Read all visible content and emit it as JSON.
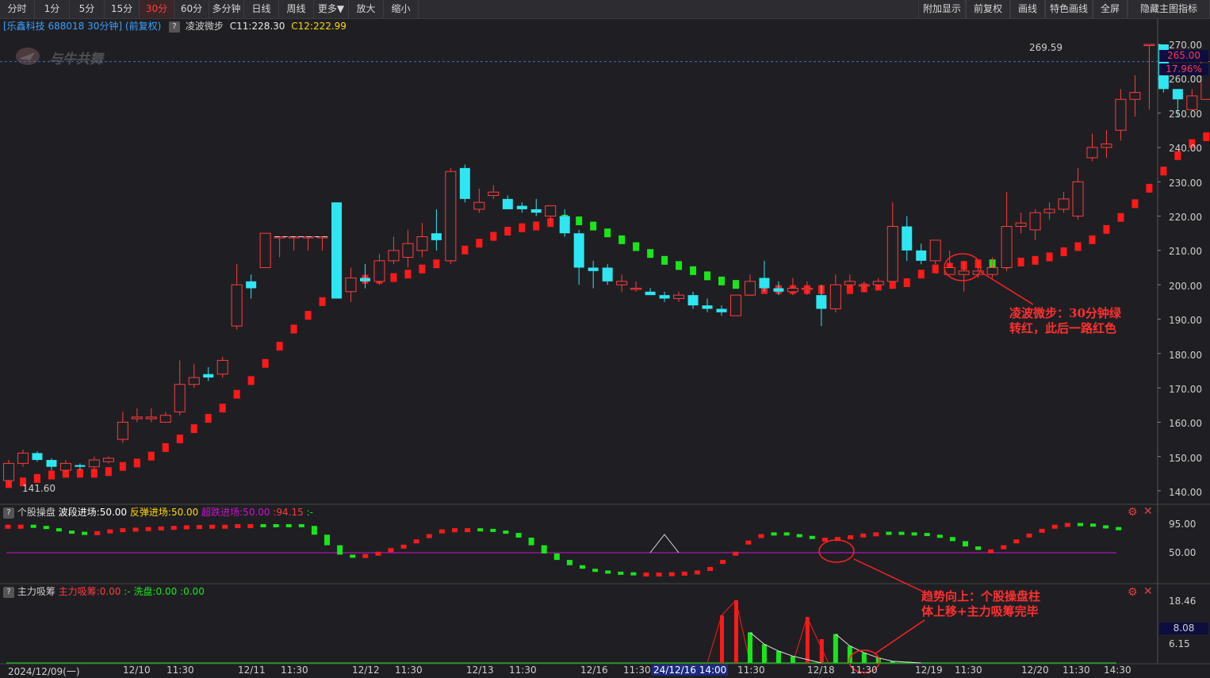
{
  "toolbar": {
    "left": [
      "分时",
      "1分",
      "5分",
      "15分",
      "30分",
      "60分",
      "多分钟",
      "日线",
      "周线",
      "更多▼",
      "放大",
      "缩小"
    ],
    "right": [
      "附加显示",
      "前复权",
      "画线",
      "特色画线",
      "全屏",
      "隐藏主图指标"
    ],
    "active": "30分"
  },
  "info": {
    "title": "[乐鑫科技 688018 30分钟] (前复权)",
    "indicator": "凌波微步",
    "c11": "C11:228.30",
    "c12": "C12:222.99"
  },
  "watermark": "与牛共舞",
  "price_axis": {
    "ticks": [
      "270.00",
      "260.00",
      "250.00",
      "240.00",
      "230.00",
      "220.00",
      "210.00",
      "200.00",
      "190.00",
      "180.00",
      "170.00",
      "160.00",
      "150.00",
      "140.00"
    ],
    "current": "265.00",
    "change": "17.96%",
    "high_label": "269.59",
    "low_label": "141.60"
  },
  "panel1": {
    "name": "个股操盘",
    "a": "波段进场:50.00",
    "b": "反弹进场:50.00",
    "c": "超跌进场:50.00",
    "d": ":94.15",
    "e": ":-",
    "ticks": [
      "95.00",
      "50.00"
    ]
  },
  "panel2": {
    "name": "主力吸筹",
    "a": "主力吸筹:0.00",
    "b": ":-",
    "c": "洗盘:0.00",
    "d": ":0.00",
    "ticks": [
      "18.46",
      "8.08",
      "6.15"
    ]
  },
  "x_axis": [
    "2024/12/09(一)",
    "12/10",
    "11:30",
    "12/11",
    "11:30",
    "12/12",
    "11:30",
    "12/13",
    "11:30",
    "12/16",
    "11:30",
    "24/12/16 14:00",
    "11:30",
    "12/18",
    "11:30",
    "12/19",
    "11:30",
    "12/20",
    "11:30",
    "14:30"
  ],
  "annotations": {
    "a1_line1": "凌波微步：30分钟绿",
    "a1_line2": "转红，此后一路红色",
    "a2_line1": "趋势向上：个股操盘柱",
    "a2_line2": "体上移+主力吸筹完毕"
  },
  "colors": {
    "up": "#ff3b3b",
    "down": "#2ee6f2",
    "green": "#19e619",
    "cyan": "#2ee6f2",
    "magenta": "#d010d0",
    "yellow": "#ffd800"
  },
  "chart_data": {
    "type": "candlestick",
    "interval": "30min",
    "ylim": [
      137,
      273
    ],
    "candles": [
      [
        143,
        148,
        141.6,
        149
      ],
      [
        148,
        151,
        147,
        152
      ],
      [
        151,
        149,
        148.5,
        151.5
      ],
      [
        149,
        147,
        146,
        149.5
      ],
      [
        146,
        148,
        145.5,
        149
      ],
      [
        147.5,
        147,
        146,
        148
      ],
      [
        147,
        149,
        146,
        150
      ],
      [
        148.5,
        149.5,
        148,
        150
      ],
      [
        155,
        160,
        154,
        163
      ],
      [
        161,
        161.5,
        160,
        164
      ],
      [
        161,
        161.5,
        160,
        164
      ],
      [
        160,
        162,
        160,
        163
      ],
      [
        163,
        171,
        162,
        178
      ],
      [
        171,
        173,
        170,
        177
      ],
      [
        174,
        173,
        172,
        176
      ],
      [
        174,
        178,
        173,
        179
      ],
      [
        188,
        200,
        187,
        206
      ],
      [
        201,
        199,
        196,
        203
      ],
      [
        205,
        215,
        205,
        215
      ],
      [
        214,
        214,
        208,
        214
      ],
      [
        214,
        214,
        210,
        214
      ],
      [
        214,
        214,
        210,
        214
      ],
      [
        214,
        214,
        210,
        214
      ],
      [
        224,
        196,
        196,
        224
      ],
      [
        198,
        202,
        195,
        205
      ],
      [
        202,
        201,
        199,
        206
      ],
      [
        201,
        207,
        200,
        209
      ],
      [
        207,
        210,
        206,
        214
      ],
      [
        208,
        212,
        205,
        216
      ],
      [
        210,
        214,
        208,
        218
      ],
      [
        215,
        213,
        210,
        222
      ],
      [
        207,
        233,
        206,
        234
      ],
      [
        234,
        225,
        224,
        235
      ],
      [
        222,
        224,
        221,
        228
      ],
      [
        226,
        227,
        225,
        229
      ],
      [
        225,
        222,
        222,
        226
      ],
      [
        223,
        222,
        221,
        224
      ],
      [
        222,
        221,
        220,
        225
      ],
      [
        220,
        223,
        218,
        223
      ],
      [
        220,
        215,
        214,
        222
      ],
      [
        215,
        205,
        200,
        216
      ],
      [
        205,
        204,
        199,
        207
      ],
      [
        205,
        201,
        200,
        206
      ],
      [
        200,
        201,
        198,
        203
      ],
      [
        199,
        199,
        198,
        201
      ],
      [
        198,
        197,
        197,
        199
      ],
      [
        197,
        196,
        195,
        198
      ],
      [
        196,
        197,
        195,
        198
      ],
      [
        197,
        194,
        193,
        198
      ],
      [
        194,
        193,
        192,
        196
      ],
      [
        193,
        192,
        191,
        194
      ],
      [
        191,
        197,
        191,
        197
      ],
      [
        197,
        201,
        197,
        203
      ],
      [
        202,
        199,
        198,
        207
      ],
      [
        199,
        198,
        197,
        201
      ],
      [
        198,
        199,
        197,
        202
      ],
      [
        199,
        199,
        197,
        201
      ],
      [
        197,
        193,
        188,
        200
      ],
      [
        193,
        200,
        192,
        203
      ],
      [
        200,
        201,
        199,
        203
      ],
      [
        200,
        200,
        198,
        201
      ],
      [
        200,
        201,
        199,
        202
      ],
      [
        201,
        217,
        201,
        224
      ],
      [
        217,
        210,
        207,
        220
      ],
      [
        210,
        207,
        206,
        212
      ],
      [
        207,
        213,
        206,
        213
      ],
      [
        203,
        205,
        203,
        210
      ],
      [
        203,
        204,
        198,
        207
      ],
      [
        203,
        204,
        202,
        207
      ],
      [
        203,
        205,
        202,
        208
      ],
      [
        205,
        217,
        204,
        227
      ],
      [
        217,
        218,
        215,
        221
      ],
      [
        216,
        221,
        213,
        222
      ],
      [
        221,
        222,
        219,
        224
      ],
      [
        222,
        225,
        221,
        227
      ],
      [
        220,
        230,
        219,
        234
      ],
      [
        237,
        240,
        236,
        244
      ],
      [
        240,
        241,
        237,
        245
      ],
      [
        245,
        254,
        242,
        257
      ],
      [
        254,
        256,
        249,
        261
      ],
      [
        270,
        270,
        251,
        270
      ],
      [
        270,
        257,
        256,
        270
      ],
      [
        257,
        254,
        249,
        257
      ],
      [
        251,
        255,
        251,
        257
      ],
      [
        254,
        265,
        254,
        265
      ]
    ],
    "lingbo": [
      [
        "r",
        142
      ],
      [
        "r",
        142.5
      ],
      [
        "r",
        143.5
      ],
      [
        "r",
        144.5
      ],
      [
        "r",
        145
      ],
      [
        "r",
        145
      ],
      [
        "r",
        145
      ],
      [
        "r",
        145.5
      ],
      [
        "r",
        147
      ],
      [
        "r",
        148
      ],
      [
        "r",
        150
      ],
      [
        "r",
        152.5
      ],
      [
        "r",
        155
      ],
      [
        "r",
        158
      ],
      [
        "r",
        161
      ],
      [
        "r",
        164
      ],
      [
        "r",
        168
      ],
      [
        "r",
        172
      ],
      [
        "r",
        177
      ],
      [
        "r",
        182
      ],
      [
        "r",
        187
      ],
      [
        "r",
        191
      ],
      [
        "r",
        195
      ],
      [
        "r",
        199
      ],
      [
        "r",
        200.5
      ],
      [
        "r",
        201.5
      ],
      [
        "r",
        201.5
      ],
      [
        "r",
        202
      ],
      [
        "r",
        203
      ],
      [
        "r",
        204.5
      ],
      [
        "r",
        206
      ],
      [
        "r",
        208
      ],
      [
        "r",
        210
      ],
      [
        "r",
        212
      ],
      [
        "r",
        214
      ],
      [
        "r",
        215.5
      ],
      [
        "r",
        216.5
      ],
      [
        "r",
        217
      ],
      [
        "r",
        218
      ],
      [
        "g",
        219
      ],
      [
        "g",
        218.5
      ],
      [
        "g",
        217
      ],
      [
        "g",
        215
      ],
      [
        "g",
        213
      ],
      [
        "g",
        211
      ],
      [
        "g",
        209
      ],
      [
        "g",
        207
      ],
      [
        "g",
        205.5
      ],
      [
        "g",
        204
      ],
      [
        "g",
        202.5
      ],
      [
        "g",
        201
      ],
      [
        "g",
        200
      ],
      [
        "r",
        198
      ],
      [
        "r",
        198.5
      ],
      [
        "r",
        198.5
      ],
      [
        "r",
        198.5
      ],
      [
        "r",
        198.5
      ],
      [
        "r",
        198.5
      ],
      [
        "r",
        198.5
      ],
      [
        "r",
        198.5
      ],
      [
        "r",
        199
      ],
      [
        "r",
        199.5
      ],
      [
        "r",
        200
      ],
      [
        "r",
        200.5
      ],
      [
        "r",
        203
      ],
      [
        "r",
        204.5
      ],
      [
        "r",
        205
      ],
      [
        "r",
        205.5
      ],
      [
        "r",
        206
      ],
      [
        "g",
        206
      ],
      [
        "g",
        206
      ],
      [
        "r",
        206.5
      ],
      [
        "r",
        207
      ],
      [
        "r",
        208
      ],
      [
        "r",
        209.5
      ],
      [
        "r",
        211
      ],
      [
        "r",
        213
      ],
      [
        "r",
        216
      ],
      [
        "r",
        219.5
      ],
      [
        "r",
        223.5
      ],
      [
        "r",
        228
      ],
      [
        "r",
        233
      ],
      [
        "r",
        237.5
      ],
      [
        "r",
        241
      ],
      [
        "r",
        243
      ]
    ],
    "panel1_series": {
      "series_name": "个股操盘",
      "reference_level": 50,
      "points": [
        [
          95,
          0
        ],
        [
          95,
          0
        ],
        [
          93,
          1
        ],
        [
          89,
          1
        ],
        [
          85,
          1
        ],
        [
          83,
          1
        ],
        [
          83,
          1
        ],
        [
          84,
          0
        ],
        [
          87,
          0
        ],
        [
          89,
          0
        ],
        [
          90,
          0
        ],
        [
          91,
          0
        ],
        [
          92,
          0
        ],
        [
          93,
          0
        ],
        [
          94,
          0
        ],
        [
          94.5,
          0
        ],
        [
          95,
          0
        ],
        [
          95,
          0
        ],
        [
          96,
          0
        ],
        [
          96,
          0
        ],
        [
          96,
          1
        ],
        [
          96,
          1
        ],
        [
          96,
          1
        ],
        [
          93,
          1
        ],
        [
          78,
          1
        ],
        [
          60,
          1
        ],
        [
          44,
          1
        ],
        [
          44,
          1
        ],
        [
          45,
          0
        ],
        [
          49,
          0
        ],
        [
          55,
          0
        ],
        [
          61,
          0
        ],
        [
          70,
          0
        ],
        [
          79,
          0
        ],
        [
          87,
          0
        ],
        [
          89,
          0
        ],
        [
          89,
          0
        ],
        [
          88,
          1
        ],
        [
          85,
          1
        ],
        [
          81,
          1
        ],
        [
          73,
          1
        ],
        [
          60,
          1
        ],
        [
          46,
          1
        ],
        [
          35,
          1
        ],
        [
          26,
          1
        ],
        [
          20,
          1
        ],
        [
          17,
          1
        ],
        [
          15,
          1
        ],
        [
          14,
          1
        ],
        [
          13.5,
          1
        ],
        [
          13.5,
          0
        ],
        [
          13.5,
          0
        ],
        [
          14,
          0
        ],
        [
          15,
          0
        ],
        [
          17,
          0
        ],
        [
          23,
          0
        ],
        [
          35,
          0
        ],
        [
          49,
          0
        ],
        [
          68,
          0
        ],
        [
          79,
          0
        ],
        [
          82,
          1
        ],
        [
          79,
          1
        ],
        [
          76,
          1
        ],
        [
          73,
          1
        ],
        [
          73,
          0
        ],
        [
          74,
          0
        ],
        [
          77,
          0
        ],
        [
          80,
          0
        ],
        [
          82,
          0
        ],
        [
          83,
          1
        ],
        [
          82,
          1
        ],
        [
          81,
          1
        ],
        [
          78,
          1
        ],
        [
          74,
          1
        ],
        [
          67,
          1
        ],
        [
          58,
          1
        ],
        [
          52,
          1
        ],
        [
          53,
          0
        ],
        [
          60,
          0
        ],
        [
          70,
          0
        ],
        [
          80,
          0
        ],
        [
          88,
          0
        ],
        [
          95,
          0
        ],
        [
          98,
          0
        ],
        [
          97,
          1
        ],
        [
          94,
          1
        ],
        [
          91,
          1
        ],
        [
          88,
          1
        ]
      ]
    },
    "panel2_series": {
      "series_name": "主力吸筹",
      "spikes": [
        [
          50,
          14
        ],
        [
          51,
          18.46
        ],
        [
          56,
          13.5
        ],
        [
          57,
          7
        ]
      ],
      "green_bars": [
        [
          52,
          9
        ],
        [
          53,
          5.5
        ],
        [
          54,
          3.5
        ],
        [
          55,
          2
        ],
        [
          58,
          8.5
        ],
        [
          59,
          5
        ],
        [
          60,
          3
        ],
        [
          61,
          1.5
        ],
        [
          62,
          0.5
        ]
      ]
    }
  }
}
